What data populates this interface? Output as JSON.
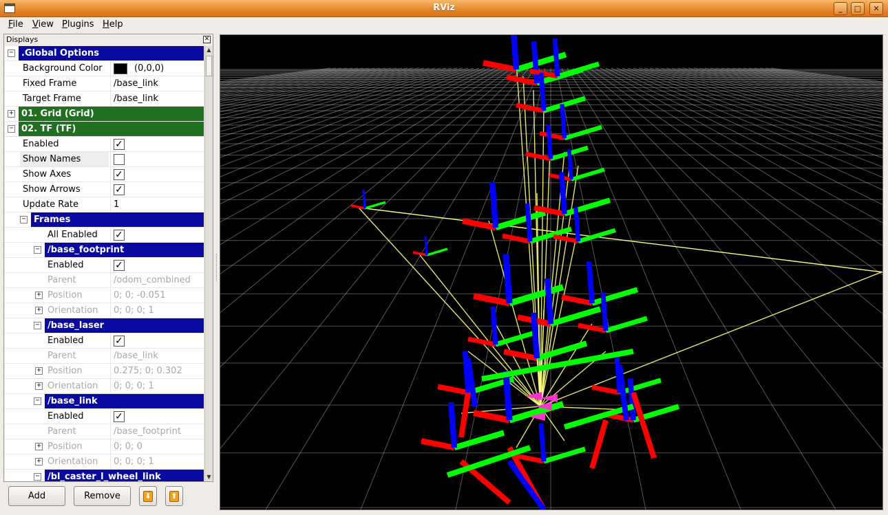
{
  "window": {
    "title": "RViz"
  },
  "menu": [
    {
      "label": "File",
      "key": "F"
    },
    {
      "label": "View",
      "key": "V"
    },
    {
      "label": "Plugins",
      "key": "P"
    },
    {
      "label": "Help",
      "key": "H"
    }
  ],
  "displays_panel": {
    "title": "Displays",
    "rows": [
      {
        "kind": "cat",
        "color": "blue",
        "indent": 0,
        "expander": "minus",
        "label": ".Global Options"
      },
      {
        "kind": "prop",
        "indent": 1,
        "label": "Background Color",
        "value": "(0,0,0)",
        "swatch": "#000000"
      },
      {
        "kind": "prop",
        "indent": 1,
        "label": "Fixed Frame",
        "value": "/base_link"
      },
      {
        "kind": "prop",
        "indent": 1,
        "label": "Target Frame",
        "value": "/base_link"
      },
      {
        "kind": "cat",
        "color": "green",
        "indent": 0,
        "expander": "plus",
        "label": "01. Grid (Grid)"
      },
      {
        "kind": "cat",
        "color": "green",
        "indent": 0,
        "expander": "minus",
        "label": "02. TF (TF)"
      },
      {
        "kind": "prop",
        "indent": 1,
        "label": "Enabled",
        "check": true
      },
      {
        "kind": "prop",
        "indent": 1,
        "label": "Show Names",
        "check": false,
        "shade": true
      },
      {
        "kind": "prop",
        "indent": 1,
        "label": "Show Axes",
        "check": true
      },
      {
        "kind": "prop",
        "indent": 1,
        "label": "Show Arrows",
        "check": true
      },
      {
        "kind": "prop",
        "indent": 1,
        "label": "Update Rate",
        "value": "1"
      },
      {
        "kind": "cat",
        "color": "blue",
        "indent": 2,
        "expander": "minus",
        "label": "Frames"
      },
      {
        "kind": "prop",
        "indent": 3,
        "label": "All Enabled",
        "check": true
      },
      {
        "kind": "cat",
        "color": "blue",
        "indent": 3,
        "expander": "minus",
        "label": "/base_footprint"
      },
      {
        "kind": "prop",
        "indent": 4,
        "label": "Enabled",
        "check": true
      },
      {
        "kind": "prop",
        "indent": 4,
        "label": "Parent",
        "value": "/odom_combined",
        "disabled": true
      },
      {
        "kind": "prop",
        "indent": 4,
        "label": "Position",
        "value": "0; 0; -0.051",
        "disabled": true,
        "expander": "plus"
      },
      {
        "kind": "prop",
        "indent": 4,
        "label": "Orientation",
        "value": "0; 0; 0; 1",
        "disabled": true,
        "expander": "plus"
      },
      {
        "kind": "cat",
        "color": "blue",
        "indent": 3,
        "expander": "minus",
        "label": "/base_laser"
      },
      {
        "kind": "prop",
        "indent": 4,
        "label": "Enabled",
        "check": true
      },
      {
        "kind": "prop",
        "indent": 4,
        "label": "Parent",
        "value": "/base_link",
        "disabled": true
      },
      {
        "kind": "prop",
        "indent": 4,
        "label": "Position",
        "value": "0.275; 0; 0.302",
        "disabled": true,
        "expander": "plus"
      },
      {
        "kind": "prop",
        "indent": 4,
        "label": "Orientation",
        "value": "0; 0; 0; 1",
        "disabled": true,
        "expander": "plus"
      },
      {
        "kind": "cat",
        "color": "blue",
        "indent": 3,
        "expander": "minus",
        "label": "/base_link"
      },
      {
        "kind": "prop",
        "indent": 4,
        "label": "Enabled",
        "check": true
      },
      {
        "kind": "prop",
        "indent": 4,
        "label": "Parent",
        "value": "/base_footprint",
        "disabled": true
      },
      {
        "kind": "prop",
        "indent": 4,
        "label": "Position",
        "value": "0; 0; 0",
        "disabled": true,
        "expander": "plus"
      },
      {
        "kind": "prop",
        "indent": 4,
        "label": "Orientation",
        "value": "0; 0; 0; 1",
        "disabled": true,
        "expander": "plus"
      },
      {
        "kind": "cat",
        "color": "blue",
        "indent": 3,
        "expander": "minus",
        "label": "/bl_caster_l_wheel_link"
      }
    ]
  },
  "buttons": {
    "add": "Add",
    "remove": "Remove",
    "move_down": "⬇",
    "move_up": "⬆"
  },
  "colors": {
    "category_blue": "#0a0aa0",
    "category_green": "#217021",
    "axis_x": "#ff0000",
    "axis_y": "#00ff00",
    "axis_z": "#0000ff",
    "tf_link": "#ffff80",
    "grid": "#a0a0a0"
  }
}
